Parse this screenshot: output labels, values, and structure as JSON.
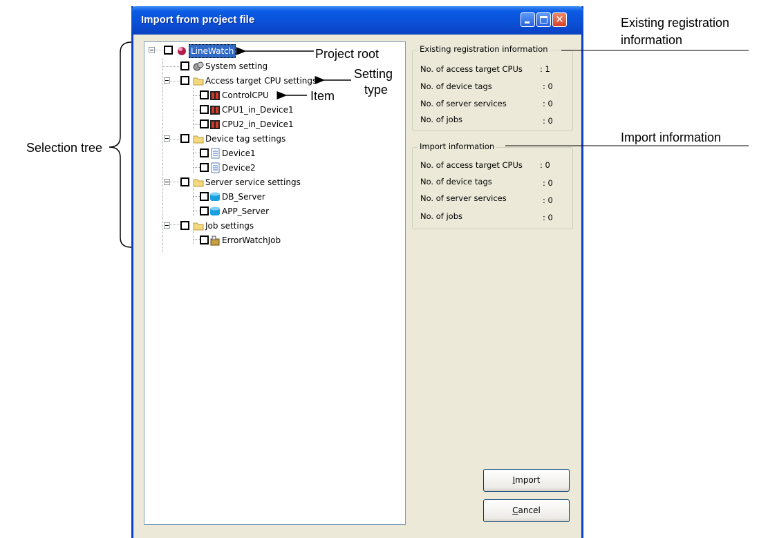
{
  "window": {
    "title": "Import from project file"
  },
  "tree": {
    "root": {
      "label": "LineWatch"
    },
    "system_setting": {
      "label": "System setting"
    },
    "groups": [
      {
        "label": "Access target CPU settings",
        "items": [
          "ControlCPU",
          "CPU1_in_Device1",
          "CPU2_in_Device1"
        ]
      },
      {
        "label": "Device tag settings",
        "items": [
          "Device1",
          "Device2"
        ]
      },
      {
        "label": "Server service settings",
        "items": [
          "DB_Server",
          "APP_Server"
        ]
      },
      {
        "label": "Job settings",
        "items": [
          "ErrorWatchJob"
        ]
      }
    ]
  },
  "existing_info": {
    "title": "Existing registration information",
    "rows": [
      {
        "label": "No. of access target CPUs",
        "value": ": 1"
      },
      {
        "label": "No. of device tags",
        "value": ": 0"
      },
      {
        "label": "No. of server services",
        "value": ": 0"
      },
      {
        "label": "No. of jobs",
        "value": ": 0"
      }
    ]
  },
  "import_info": {
    "title": "Import information",
    "rows": [
      {
        "label": "No. of access target CPUs",
        "value": ": 0"
      },
      {
        "label": "No. of device tags",
        "value": ": 0"
      },
      {
        "label": "No. of server services",
        "value": ": 0"
      },
      {
        "label": "No. of jobs",
        "value": ": 0"
      }
    ]
  },
  "buttons": {
    "import": {
      "mnemonic": "I",
      "rest": "mport"
    },
    "cancel": {
      "mnemonic": "C",
      "rest": "ancel"
    }
  },
  "callouts": {
    "project_root": "Project root",
    "setting_type_1": "Setting",
    "setting_type_2": "type",
    "item": "Item",
    "selection_tree": "Selection tree",
    "existing_1": "Existing registration",
    "existing_2": "information",
    "import_info": "Import information"
  }
}
